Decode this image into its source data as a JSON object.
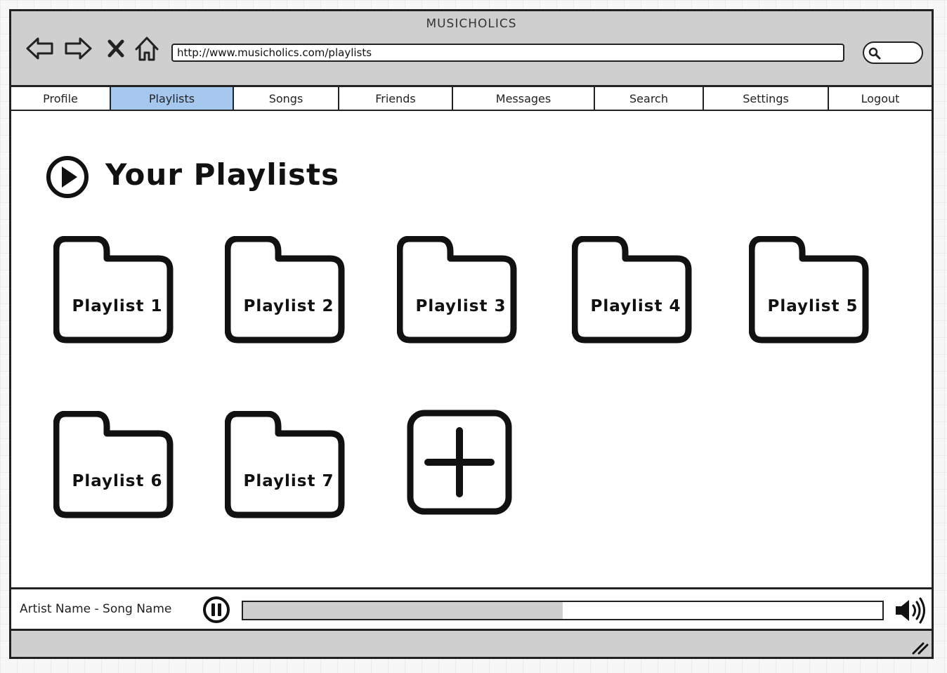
{
  "window": {
    "title": "MUSICHOLICS"
  },
  "toolbar": {
    "back_icon": "back-arrow-icon",
    "forward_icon": "forward-arrow-icon",
    "stop_icon": "close-icon",
    "home_icon": "home-icon",
    "url": "http://www.musicholics.com/playlists",
    "search_icon": "search-icon"
  },
  "tabs": [
    {
      "label": "Profile",
      "active": false
    },
    {
      "label": "Playlists",
      "active": true
    },
    {
      "label": "Songs",
      "active": false
    },
    {
      "label": "Friends",
      "active": false
    },
    {
      "label": "Messages",
      "active": false
    },
    {
      "label": "Search",
      "active": false
    },
    {
      "label": "Settings",
      "active": false
    },
    {
      "label": "Logout",
      "active": false
    }
  ],
  "main": {
    "heading": "Your Playlists",
    "heading_icon": "play-circle-icon",
    "playlists": [
      "Playlist 1",
      "Playlist 2",
      "Playlist 3",
      "Playlist 4",
      "Playlist 5",
      "Playlist 6",
      "Playlist 7"
    ],
    "add_icon": "add-icon"
  },
  "player": {
    "now_playing": "Artist Name - Song Name",
    "pause_icon": "pause-icon",
    "progress": 0.5,
    "volume_icon": "volume-icon"
  },
  "colors": {
    "active_tab": "#a7c8ee",
    "chrome": "#cfcfcf",
    "stroke": "#222222"
  }
}
